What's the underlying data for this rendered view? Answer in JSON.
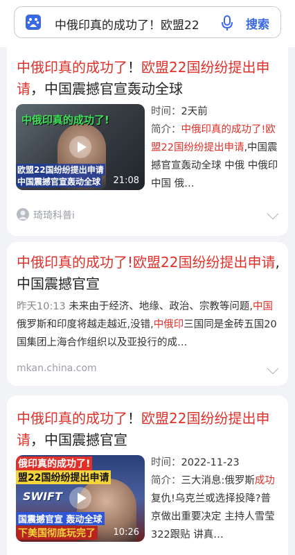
{
  "search": {
    "query": "中俄印真的成功了！欧盟22",
    "button": "搜索",
    "brand_color": "#3868e6"
  },
  "results": [
    {
      "title_parts": [
        "中俄印真的成功了",
        "！",
        "欧盟22国纷纷提出申请",
        "，中国震撼官宣轰动全球"
      ],
      "thumb_caption_top": "中俄印真的成功了!",
      "thumb_caption_bottom1": "欧盟22国纷纷提出申请",
      "thumb_caption_bottom2": "中国震撼官宣轰动全球",
      "duration": "21:08",
      "time_label": "时间：",
      "time": "2天前",
      "summary_label": "简介：",
      "summary_hl": "中俄印真的成功了!欧盟22国纷纷提出申请",
      "summary_rest": ",中国震撼官宣轰动全球 中俄 中俄印 中国 俄…",
      "author": "琦琦科普i"
    },
    {
      "title_parts": [
        "中俄印真的成功了!欧盟22国纷纷提出申请",
        ",中国震撼官宣"
      ],
      "date": "昨天10:13",
      "snip_a": " 未来由于经济、地缘、政治、宗教等问题,",
      "snip_hl1": "中国",
      "snip_b": "俄罗斯和印度将越走越近,没错,",
      "snip_hl2": "中俄印",
      "snip_c": "三国同是金砖五国20国集团上海合作组织以及亚投行的成…",
      "source": "mkan.china.com"
    },
    {
      "title_parts": [
        "中俄印真的成功了",
        "！",
        "欧盟22国纷纷提出申请",
        "，中国震撼官宣"
      ],
      "thumb_line1": "俄印真的成功了!",
      "thumb_line2": "盟22国纷纷提出申请",
      "thumb_swift": "SWIFT",
      "thumb_line3": "国震撼官宣 轰动全球",
      "thumb_line4": "下美国彻底玩完了",
      "duration": "10:26",
      "time_label": "时间：",
      "time": "2022-11-23",
      "summary_label": "简介：",
      "summary_a": "三大消息:俄罗斯",
      "summary_hl": "成功",
      "summary_b": "复仇!乌克兰或选择投降?普京做出重要决定 主持人雪莹322跟贴 讲真…"
    }
  ]
}
